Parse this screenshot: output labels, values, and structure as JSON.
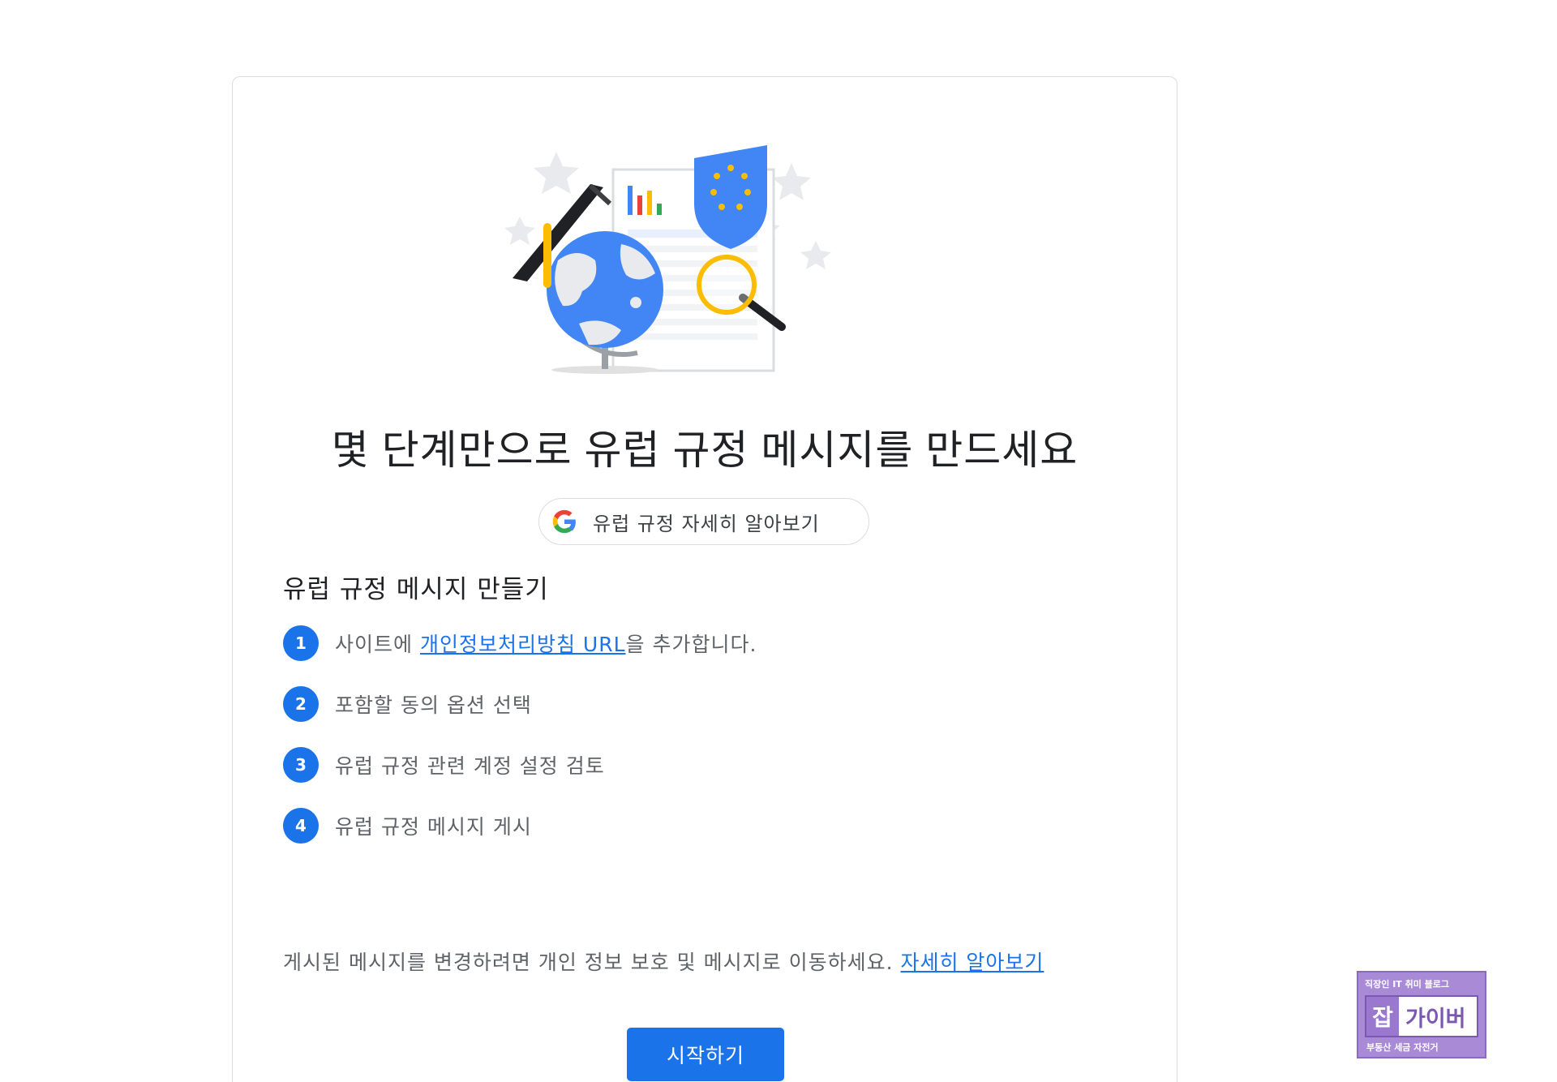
{
  "card": {
    "headline": "몇 단계만으로 유럽 규정 메시지를 만드세요",
    "learn_more_pill": "유럽 규정 자세히 알아보기",
    "section_title": "유럽 규정 메시지 만들기",
    "steps": [
      {
        "number": "1",
        "prefix": "사이트에 ",
        "link": "개인정보처리방침 URL",
        "suffix": "을 추가합니다."
      },
      {
        "number": "2",
        "text": "포함할 동의 옵션 선택"
      },
      {
        "number": "3",
        "text": "유럽 규정 관련 계정 설정 검토"
      },
      {
        "number": "4",
        "text": "유럽 규정 메시지 게시"
      }
    ],
    "footnote": {
      "text": "게시된 메시지를 변경하려면 개인 정보 보호 및 메시지로 이동하세요. ",
      "link": "자세히 알아보기"
    },
    "start_button": "시작하기"
  },
  "watermark": {
    "top_text": "직장인 IT 취미 블로그",
    "brand_char": "잡",
    "brand_name": "가이버",
    "bottom_text": "부동산 세금 자전거"
  },
  "colors": {
    "accent": "#1a73e8",
    "text": "#202124",
    "muted": "#5f6368",
    "badge": "#a98ad6"
  }
}
